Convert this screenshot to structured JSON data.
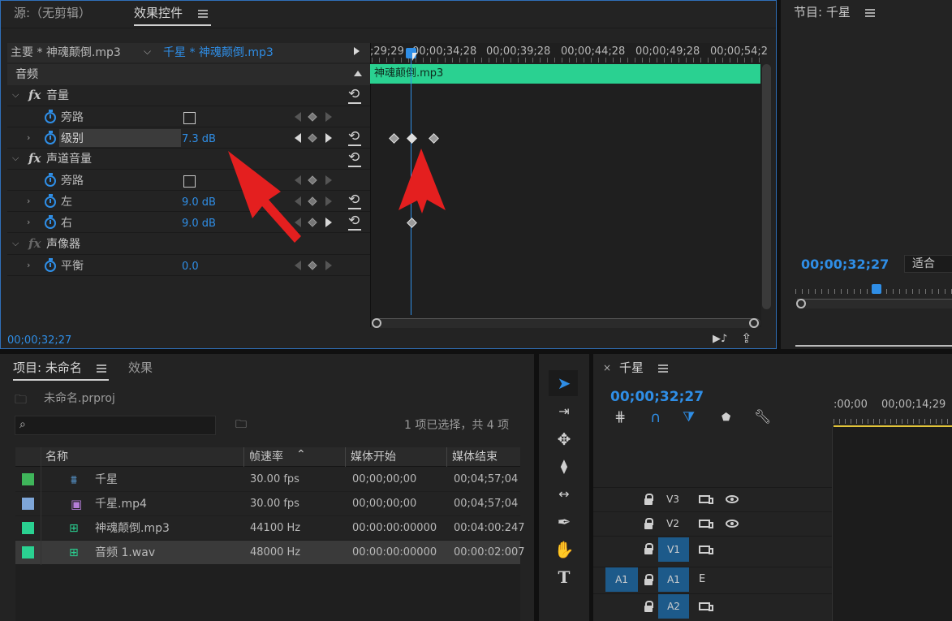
{
  "effect_controls": {
    "source_tab": "源:（无剪辑）",
    "effects_tab": "效果控件",
    "master_clip": "主要 * 神魂颠倒.mp3",
    "seq_clip": "千星 * 神魂颠倒.mp3",
    "timecodes": ";29;29",
    "ruler_labels": [
      "00;00;34;28",
      "00;00;39;28",
      "00;00;44;28",
      "00;00;49;28",
      "00;00;54;2"
    ],
    "ruler_first": ";29;29",
    "clip_label": "神魂颠倒.mp3",
    "section_audio": "音频",
    "effects": {
      "volume": "音量",
      "bypass": "旁路",
      "level": "级别",
      "level_value": "7.3 dB",
      "channel_volume": "声道音量",
      "bypass2": "旁路",
      "left": "左",
      "left_value": "9.0 dB",
      "right": "右",
      "right_value": "9.0 dB",
      "panner": "声像器",
      "balance": "平衡",
      "balance_value": "0.0"
    },
    "current_time": "00;00;32;27",
    "clip_color": "#2ad191"
  },
  "program_monitor": {
    "title": "节目: 千星",
    "timecode": "00;00;32;27",
    "fit": "适合"
  },
  "project": {
    "tab": "项目: 未命名",
    "effects_tab": "效果",
    "file": "未命名.prproj",
    "selection_info": "1 项已选择，共 4 项",
    "columns": [
      "名称",
      "帧速率",
      "媒体开始",
      "媒体结束"
    ],
    "rows": [
      {
        "name": "千星",
        "rate": "30.00 fps",
        "start": "00;00;00;00",
        "end": "00;04;57;04",
        "color": "#3fb55a"
      },
      {
        "name": "千星.mp4",
        "rate": "30.00 fps",
        "start": "00;00;00;00",
        "end": "00;04;57;04",
        "color": "#7ea6d8"
      },
      {
        "name": "神魂颠倒.mp3",
        "rate": "44100 Hz",
        "start": "00:00:00:00000",
        "end": "00:04:00:247",
        "color": "#2ad191"
      },
      {
        "name": "音频 1.wav",
        "rate": "48000 Hz",
        "start": "00:00:00:00000",
        "end": "00:00:02:007",
        "color": "#2ad191"
      }
    ]
  },
  "timeline": {
    "title": "千星",
    "timecode": "00;00;32;27",
    "ruler_labels": [
      ":00;00",
      "00;00;14;29"
    ],
    "tracks": {
      "v3": "V3",
      "v2": "V2",
      "v1": "V1",
      "a1_src": "A1",
      "a1": "A1",
      "a2": "A2",
      "e": "E"
    }
  }
}
